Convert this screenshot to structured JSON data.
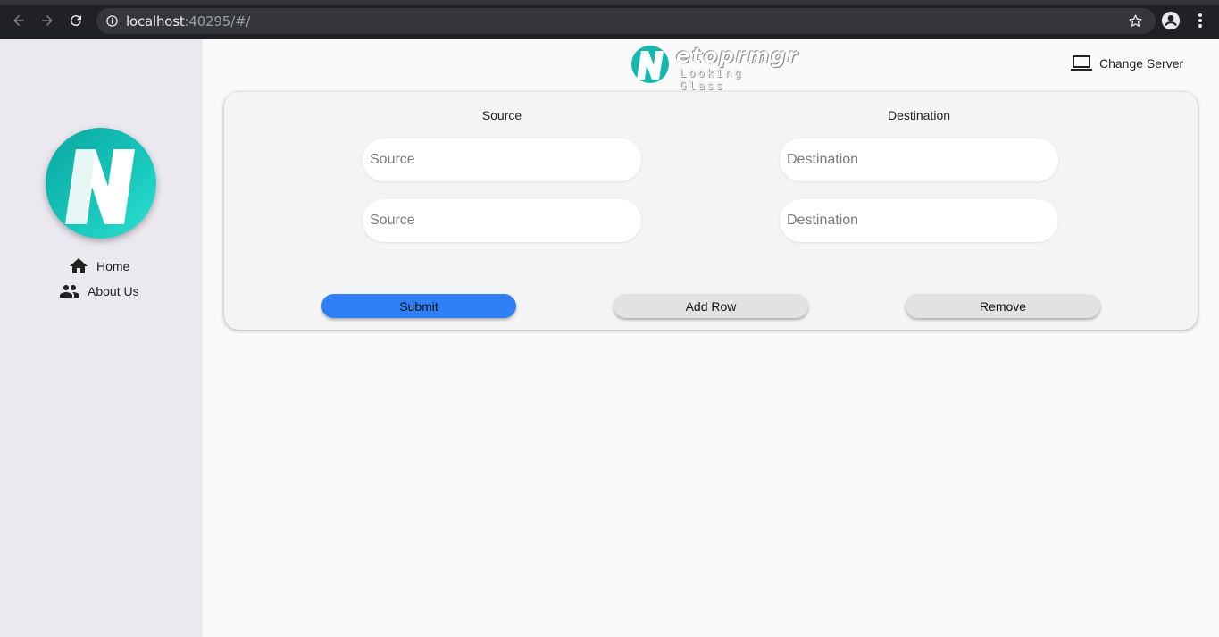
{
  "browser": {
    "url_host": "localhost",
    "url_rest": ":40295/#/"
  },
  "header": {
    "brand_text": "etoprmgr",
    "brand_subtitle": "Looking Glass",
    "change_server_label": "Change Server"
  },
  "sidebar": {
    "items": [
      {
        "label": "Home",
        "icon": "home-icon"
      },
      {
        "label": "About Us",
        "icon": "people-icon"
      }
    ]
  },
  "form": {
    "source_header": "Source",
    "destination_header": "Destination",
    "rows": [
      {
        "source_placeholder": "Source",
        "destination_placeholder": "Destination"
      },
      {
        "source_placeholder": "Source",
        "destination_placeholder": "Destination"
      }
    ],
    "buttons": {
      "submit": "Submit",
      "add_row": "Add Row",
      "remove": "Remove"
    }
  },
  "colors": {
    "accent": "#2f80f7",
    "brand_teal": "#18c8bd",
    "sidebar_bg": "#ece8f0"
  }
}
